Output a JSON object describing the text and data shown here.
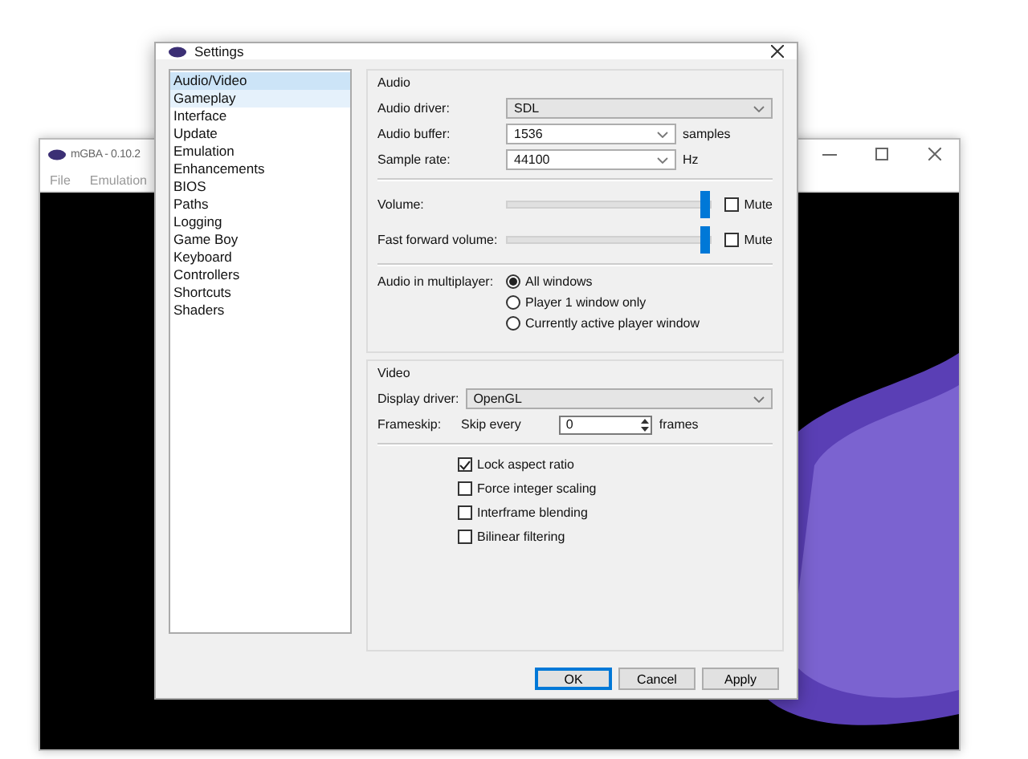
{
  "main_window": {
    "title": "mGBA - 0.10.2",
    "menu": [
      "File",
      "Emulation"
    ]
  },
  "settings": {
    "title": "Settings",
    "sidebar": {
      "items": [
        {
          "label": "Audio/Video",
          "selected": true,
          "hovered": false
        },
        {
          "label": "Gameplay",
          "selected": false,
          "hovered": true
        },
        {
          "label": "Interface",
          "selected": false,
          "hovered": false
        },
        {
          "label": "Update",
          "selected": false,
          "hovered": false
        },
        {
          "label": "Emulation",
          "selected": false,
          "hovered": false
        },
        {
          "label": "Enhancements",
          "selected": false,
          "hovered": false
        },
        {
          "label": "BIOS",
          "selected": false,
          "hovered": false
        },
        {
          "label": "Paths",
          "selected": false,
          "hovered": false
        },
        {
          "label": "Logging",
          "selected": false,
          "hovered": false
        },
        {
          "label": "Game Boy",
          "selected": false,
          "hovered": false
        },
        {
          "label": "Keyboard",
          "selected": false,
          "hovered": false
        },
        {
          "label": "Controllers",
          "selected": false,
          "hovered": false
        },
        {
          "label": "Shortcuts",
          "selected": false,
          "hovered": false
        },
        {
          "label": "Shaders",
          "selected": false,
          "hovered": false
        }
      ]
    },
    "audio": {
      "title": "Audio",
      "audio_driver": {
        "label": "Audio driver:",
        "value": "SDL"
      },
      "audio_buffer": {
        "label": "Audio buffer:",
        "value": "1536",
        "unit": "samples"
      },
      "sample_rate": {
        "label": "Sample rate:",
        "value": "44100",
        "unit": "Hz"
      },
      "volumes": [
        {
          "label": "Volume:",
          "level": 1.0,
          "mute_label": "Mute",
          "muted": false
        },
        {
          "label": "Fast forward volume:",
          "level": 1.0,
          "mute_label": "Mute",
          "muted": false
        }
      ],
      "multiplayer": {
        "label": "Audio in multiplayer:",
        "options": [
          {
            "label": "All windows",
            "selected": true
          },
          {
            "label": "Player 1 window only",
            "selected": false
          },
          {
            "label": "Currently active player window",
            "selected": false
          }
        ]
      }
    },
    "video": {
      "title": "Video",
      "display_driver": {
        "label": "Display driver:",
        "value": "OpenGL"
      },
      "frameskip": {
        "label": "Frameskip:",
        "prefix": "Skip every",
        "value": "0",
        "unit": "frames"
      },
      "options": [
        {
          "label": "Lock aspect ratio",
          "checked": true
        },
        {
          "label": "Force integer scaling",
          "checked": false
        },
        {
          "label": "Interframe blending",
          "checked": false
        },
        {
          "label": "Bilinear filtering",
          "checked": false
        }
      ]
    },
    "buttons": [
      {
        "label": "OK",
        "default": true
      },
      {
        "label": "Cancel",
        "default": false
      },
      {
        "label": "Apply",
        "default": false
      }
    ]
  }
}
